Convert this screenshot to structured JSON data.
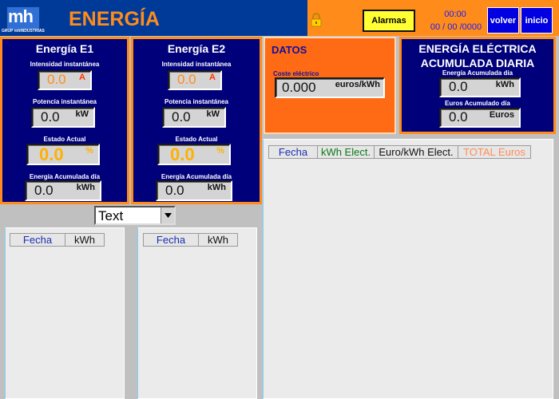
{
  "header": {
    "title": "ENERGÍA",
    "logo_text": "mh",
    "logo_subtitle": "GRUP mhINDUSTRIAS",
    "alarm_button": "Alarmas",
    "time": "00:00",
    "date": "00 / 00 /0000",
    "back_button": "volver",
    "home_button": "inicio"
  },
  "e1": {
    "title": "Energía E1",
    "intensity_label": "Intensidad instantánea",
    "intensity_value": "0.0",
    "intensity_unit": "A",
    "power_label": "Potencia instantánea",
    "power_value": "0.0",
    "power_unit": "kW",
    "state_label": "Estado Actual",
    "state_value": "0.0",
    "state_unit": "%",
    "energy_label": "Energía Acumulada día",
    "energy_value": "0.0",
    "energy_unit": "kWh"
  },
  "e2": {
    "title": "Energía E2",
    "intensity_label": "Intensidad instantánea",
    "intensity_value": "0.0",
    "intensity_unit": "A",
    "power_label": "Potencia instantánea",
    "power_value": "0.0",
    "power_unit": "kW",
    "state_label": "Estado Actual",
    "state_value": "0.0",
    "state_unit": "%",
    "energy_label": "Energía Acumulada día",
    "energy_value": "0.0",
    "energy_unit": "kWh"
  },
  "datos": {
    "title": "DATOS",
    "cost_label": "Coste eléctrico",
    "cost_value": "0.000",
    "cost_unit": "euros/kWh"
  },
  "daily": {
    "title_line1": "ENERGÍA ELÉCTRICA",
    "title_line2": "ACUMULADA DIARIA",
    "energy_label": "Energía Acumulada día",
    "energy_value": "0.0",
    "energy_unit": "kWh",
    "euros_label": "Euros Acumulado día",
    "euros_value": "0.0",
    "euros_unit": "Euros"
  },
  "selector": {
    "value": "Text"
  },
  "table_left": {
    "columns": [
      "Fecha",
      "kWh"
    ]
  },
  "table_mid": {
    "columns": [
      "Fecha",
      "kWh"
    ]
  },
  "table_right": {
    "columns": [
      "Fecha",
      "kWh Elect.",
      "Euro/kWh Elect.",
      "TOTAL Euros"
    ]
  },
  "colors": {
    "header_blue": "#003a99",
    "header_orange": "#ff8c1a",
    "panel_blue": "#00007a",
    "alarm_yellow": "#ffff33",
    "datos_orange": "#ff6a14"
  }
}
